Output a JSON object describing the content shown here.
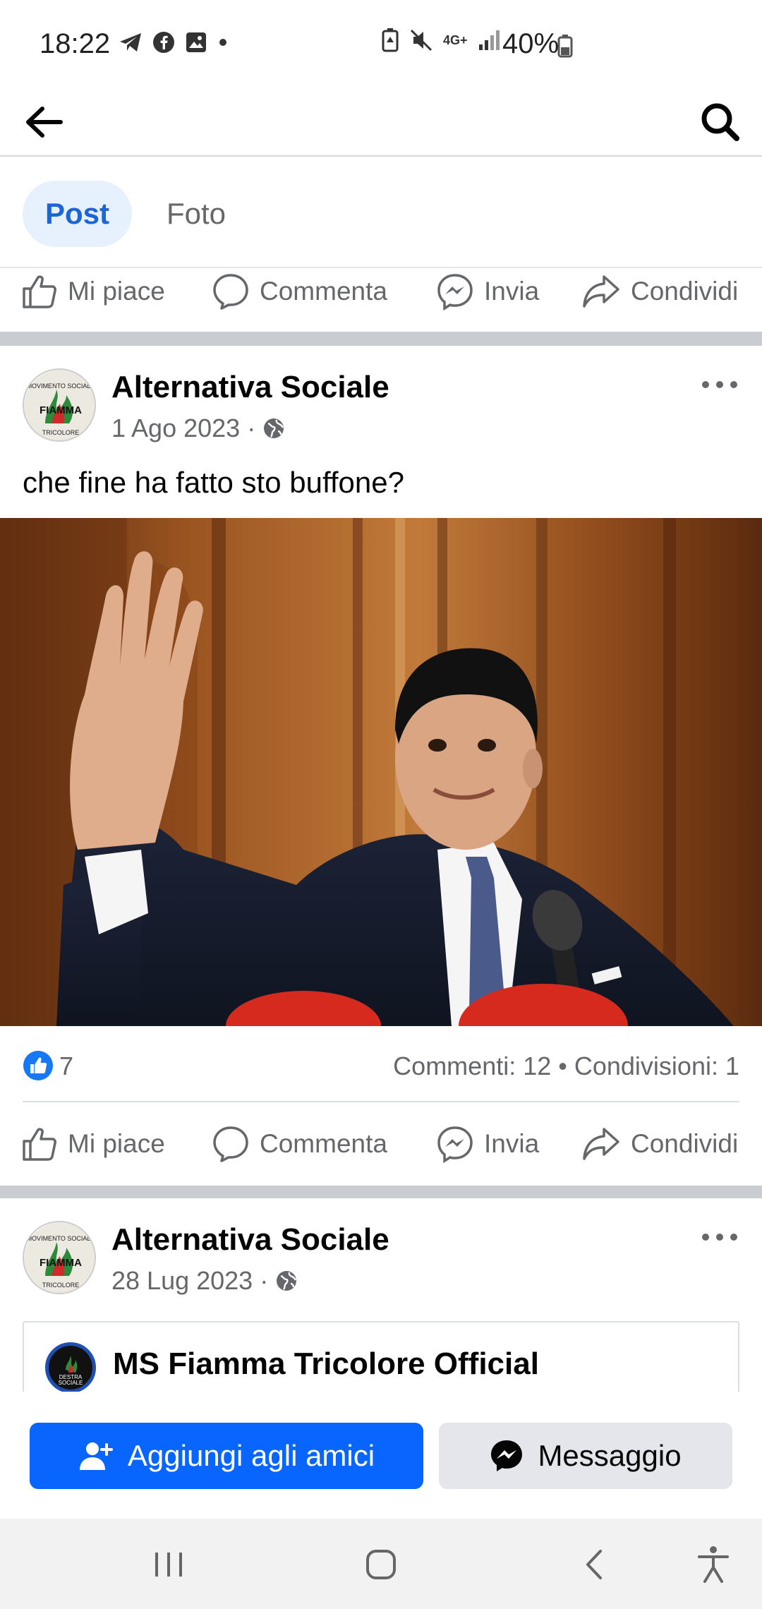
{
  "status_bar": {
    "time": "18:22",
    "battery": "40%",
    "network": "4G+"
  },
  "header": {
    "back_icon": "arrow-left-icon",
    "search_icon": "search-icon"
  },
  "tabs": [
    {
      "label": "Post",
      "active": true
    },
    {
      "label": "Foto",
      "active": false
    }
  ],
  "actions": {
    "like": "Mi piace",
    "comment": "Commenta",
    "send": "Invia",
    "share": "Condividi"
  },
  "posts": [
    {
      "author": "Alternativa Sociale",
      "date": "1 Ago 2023",
      "separator": "·",
      "text": "che fine ha fatto sto buffone?",
      "likes": "7",
      "stats": "Commenti: 12 • Condivisioni: 1"
    },
    {
      "author": "Alternativa Sociale",
      "date": "28 Lug 2023",
      "separator": "·",
      "shared_title": "MS Fiamma Tricolore  Official"
    }
  ],
  "avatar_logo": {
    "top_text": "MOVIMENTO SOCIALE",
    "middle_text": "FIAMMA",
    "bottom_text": "TRICOLORE"
  },
  "shared_logo": {
    "line1": "DESTRA",
    "line2": "SOCIALE"
  },
  "bottom_actions": {
    "add_friend": "Aggiungi agli amici",
    "message": "Messaggio"
  },
  "colors": {
    "accent": "#0866ff",
    "tab_active_bg": "#e7f0fd",
    "tab_active_text": "#1b66d2",
    "secondary_text": "#65676b"
  }
}
